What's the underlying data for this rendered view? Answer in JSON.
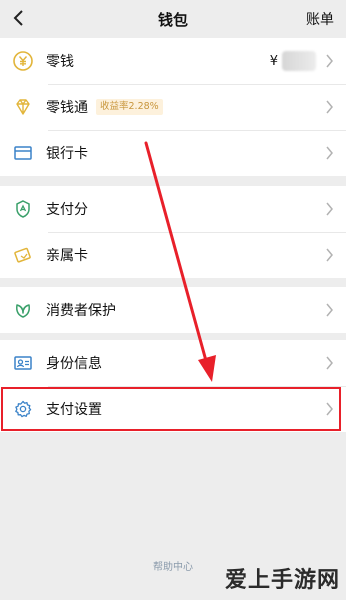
{
  "nav": {
    "title": "钱包",
    "right": "账单"
  },
  "rows": {
    "change": {
      "label": "零钱",
      "currency": "¥"
    },
    "change_plus": {
      "label": "零钱通",
      "badge": "收益率2.28%"
    },
    "bank_card": {
      "label": "银行卡"
    },
    "pay_score": {
      "label": "支付分"
    },
    "family_card": {
      "label": "亲属卡"
    },
    "consumer_protection": {
      "label": "消费者保护"
    },
    "identity": {
      "label": "身份信息"
    },
    "pay_settings": {
      "label": "支付设置"
    }
  },
  "footer": {
    "help": "帮助中心"
  },
  "watermark": "爱上手游网",
  "colors": {
    "accent_gold": "#e2b53a",
    "icon_green": "#3aa06a",
    "icon_blue": "#3a82c8",
    "highlight_red": "#e8202a"
  },
  "icons": {
    "back": "chevron-left-icon",
    "change": "yuan-coin-icon",
    "change_plus": "diamond-icon",
    "bank_card": "card-icon",
    "pay_score": "shield-score-icon",
    "family_card": "family-card-icon",
    "consumer_protection": "leaf-protect-icon",
    "identity": "id-card-icon",
    "pay_settings": "gear-icon"
  }
}
